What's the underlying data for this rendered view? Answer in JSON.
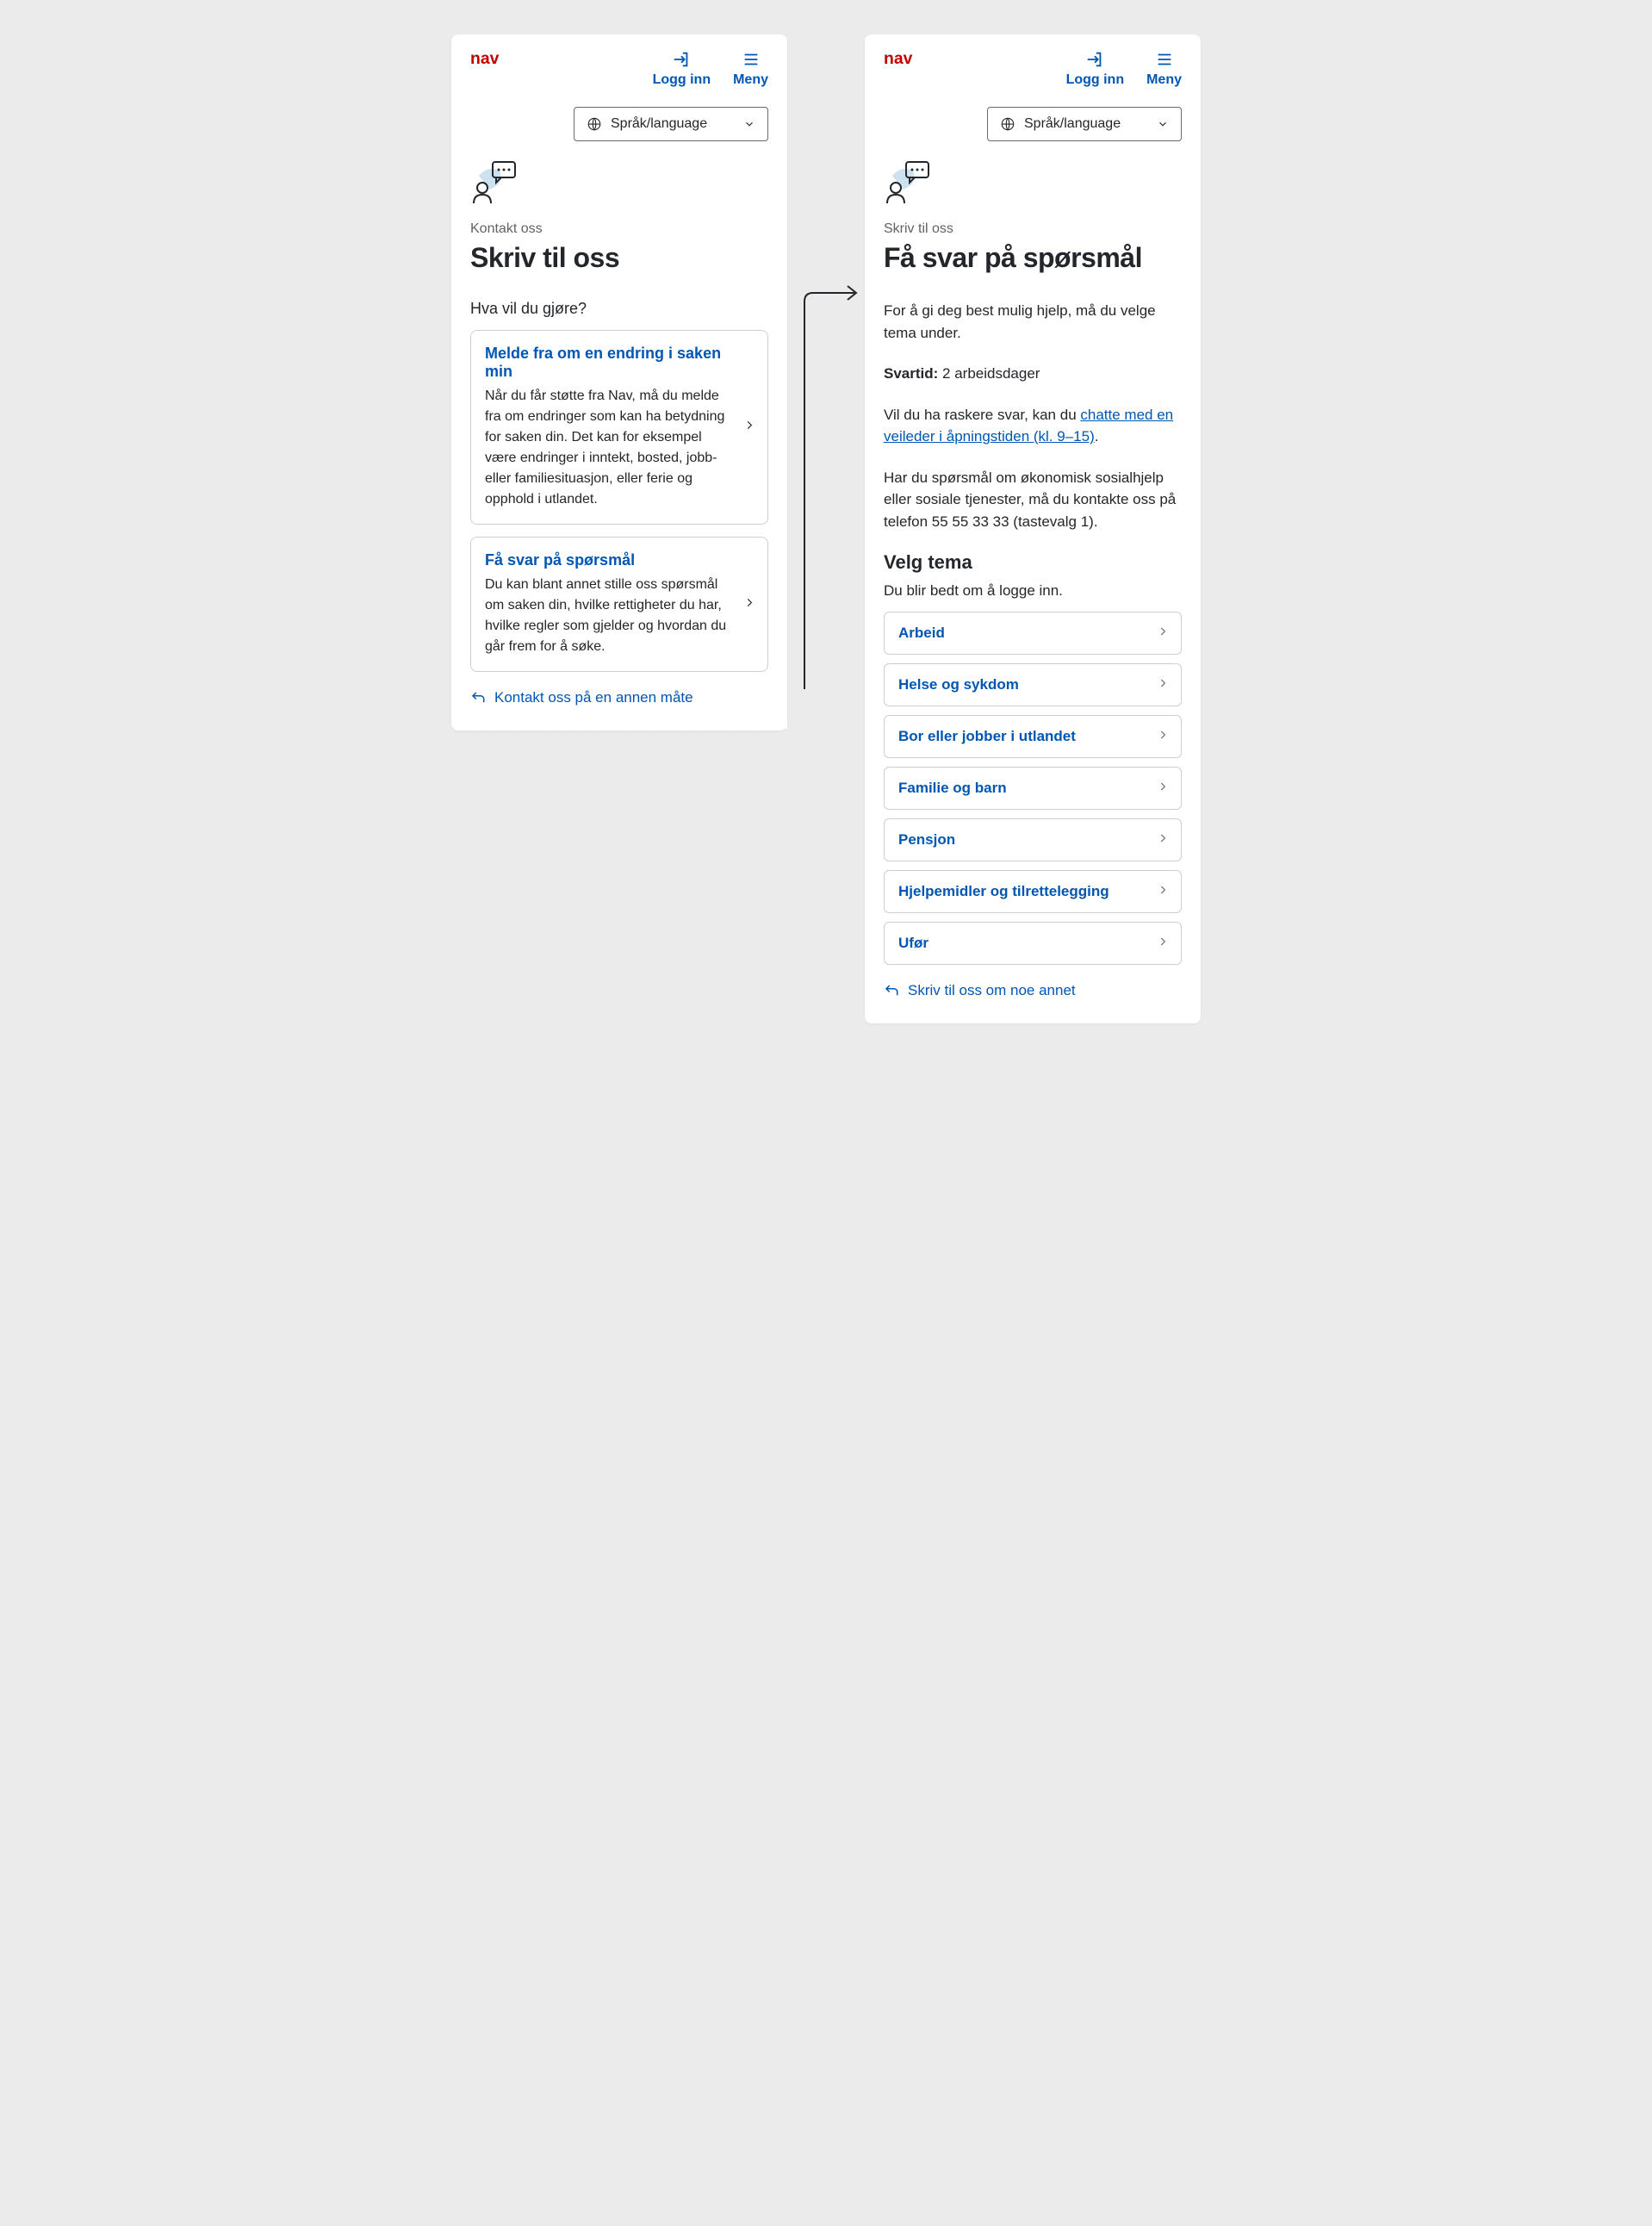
{
  "header": {
    "login": "Logg inn",
    "menu": "Meny",
    "language": "Språk/language"
  },
  "left": {
    "breadcrumb": "Kontakt oss",
    "title": "Skriv til oss",
    "subtitle": "Hva vil du gjøre?",
    "cards": [
      {
        "title": "Melde fra om en endring i saken min",
        "desc": "Når du får støtte fra Nav, må du melde fra om endringer som kan ha betydning for saken din. Det kan for eksempel være endringer i inntekt, bosted, jobb- eller familiesituasjon, eller ferie og opphold i utlandet."
      },
      {
        "title": "Få svar på spørsmål",
        "desc": "Du kan blant annet stille oss spørsmål om saken din, hvilke rettigheter du har, hvilke regler som gjelder og hvordan du går frem for å søke."
      }
    ],
    "back": "Kontakt oss på en annen måte"
  },
  "right": {
    "breadcrumb": "Skriv til oss",
    "title": "Få svar på spørsmål",
    "intro1": "For å gi deg best mulig hjelp, må du velge tema under.",
    "svartid_label": "Svartid:",
    "svartid_value": " 2 arbeidsdager",
    "intro3_pre": "Vil du ha raskere svar, kan du ",
    "intro3_link": "chatte med en veileder i åpningstiden (kl. 9–15)",
    "intro3_post": ".",
    "intro4": "Har du spørsmål om økonomisk sosialhjelp eller sosiale tjenester, må du kontakte oss på telefon 55 55 33 33 (tastevalg 1).",
    "section_title": "Velg tema",
    "hint": "Du blir bedt om å logge inn.",
    "topics": [
      "Arbeid",
      "Helse og sykdom",
      "Bor eller jobber i utlandet",
      "Familie og barn",
      "Pensjon",
      "Hjelpemidler og tilrettelegging",
      "Ufør"
    ],
    "back": "Skriv til oss om noe annet"
  }
}
